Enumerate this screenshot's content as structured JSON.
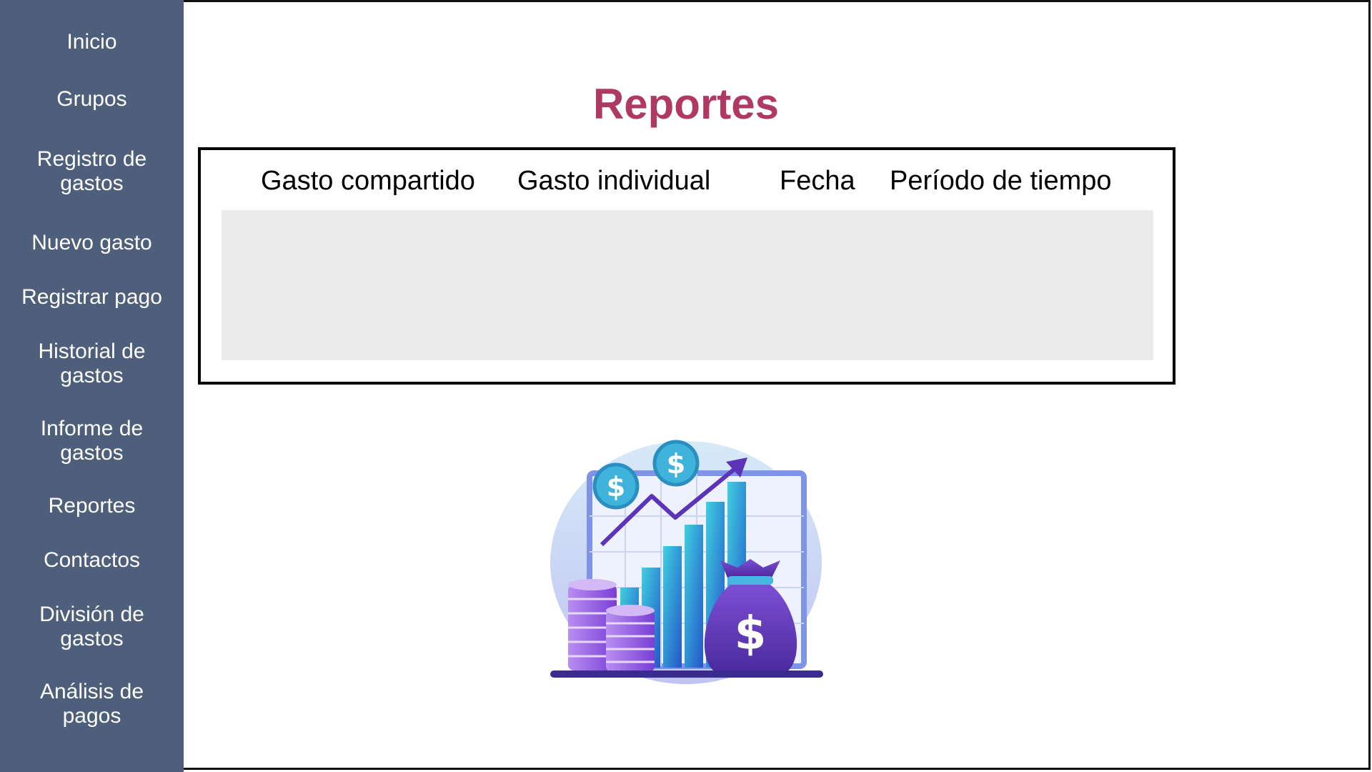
{
  "sidebar": {
    "items": [
      {
        "label": "Inicio"
      },
      {
        "label": "Grupos"
      },
      {
        "label_lines": [
          "Registro de",
          "gastos"
        ]
      },
      {
        "label": "Nuevo gasto"
      },
      {
        "label": "Registrar pago"
      },
      {
        "label_lines": [
          "Historial de",
          "gastos"
        ]
      },
      {
        "label_lines": [
          "Informe de",
          "gastos"
        ]
      },
      {
        "label": "Reportes"
      },
      {
        "label": "Contactos"
      },
      {
        "label_lines": [
          "División de",
          "gastos"
        ]
      },
      {
        "label_lines": [
          "Análisis de",
          "pagos"
        ]
      }
    ]
  },
  "main": {
    "title": "Reportes",
    "report_table": {
      "columns": [
        "Gasto compartido",
        "Gasto individual",
        "Fecha",
        "Período de tiempo"
      ]
    }
  },
  "colors": {
    "sidebar_bg": "#4d5f7a",
    "title": "#b03a5f",
    "results_bg": "#ebebeb"
  },
  "illustration": {
    "icons": [
      "dollar-coin-icon",
      "trend-arrow-icon",
      "coin-stack-icon",
      "money-bag-icon"
    ]
  }
}
